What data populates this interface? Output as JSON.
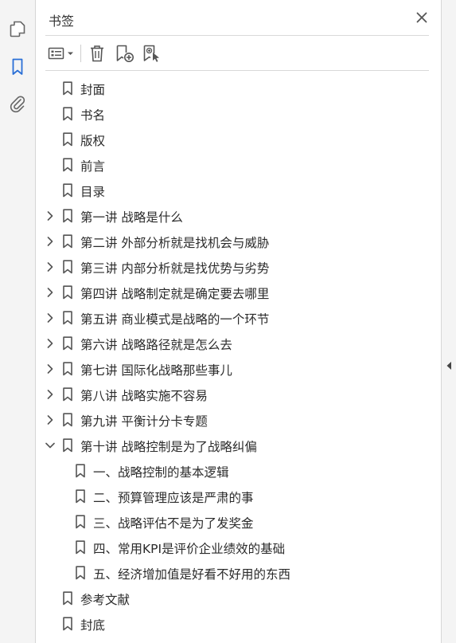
{
  "panel": {
    "title": "书签"
  },
  "icons": {
    "rail": [
      "pages-icon",
      "bookmarks-icon",
      "attachments-icon"
    ],
    "toolbar": [
      "options-menu-icon",
      "delete-bookmark-icon",
      "new-bookmark-icon",
      "new-bookmark-from-structure-icon"
    ],
    "close": "close-icon"
  },
  "colors": {
    "accent": "#2a6fd6",
    "icon": "#555555",
    "separator": "#d9d9d9"
  },
  "bookmarks": [
    {
      "label": "封面",
      "level": 0,
      "expander": "none"
    },
    {
      "label": "书名",
      "level": 0,
      "expander": "none"
    },
    {
      "label": "版权",
      "level": 0,
      "expander": "none"
    },
    {
      "label": "前言",
      "level": 0,
      "expander": "none"
    },
    {
      "label": "目录",
      "level": 0,
      "expander": "none"
    },
    {
      "label": "第一讲  战略是什么",
      "level": 0,
      "expander": "collapsed"
    },
    {
      "label": "第二讲  外部分析就是找机会与威胁",
      "level": 0,
      "expander": "collapsed"
    },
    {
      "label": "第三讲  内部分析就是找优势与劣势",
      "level": 0,
      "expander": "collapsed"
    },
    {
      "label": "第四讲  战略制定就是确定要去哪里",
      "level": 0,
      "expander": "collapsed"
    },
    {
      "label": "第五讲  商业模式是战略的一个环节",
      "level": 0,
      "expander": "collapsed"
    },
    {
      "label": "第六讲  战略路径就是怎么去",
      "level": 0,
      "expander": "collapsed"
    },
    {
      "label": "第七讲  国际化战略那些事儿",
      "level": 0,
      "expander": "collapsed"
    },
    {
      "label": "第八讲  战略实施不容易",
      "level": 0,
      "expander": "collapsed"
    },
    {
      "label": "第九讲  平衡计分卡专题",
      "level": 0,
      "expander": "collapsed"
    },
    {
      "label": "第十讲  战略控制是为了战略纠偏",
      "level": 0,
      "expander": "expanded"
    },
    {
      "label": "一、战略控制的基本逻辑",
      "level": 1,
      "expander": "none"
    },
    {
      "label": "二、预算管理应该是严肃的事",
      "level": 1,
      "expander": "none"
    },
    {
      "label": "三、战略评估不是为了发奖金",
      "level": 1,
      "expander": "none"
    },
    {
      "label": "四、常用KPI是评价企业绩效的基础",
      "level": 1,
      "expander": "none"
    },
    {
      "label": "五、经济增加值是好看不好用的东西",
      "level": 1,
      "expander": "none"
    },
    {
      "label": "参考文献",
      "level": 0,
      "expander": "none"
    },
    {
      "label": "封底",
      "level": 0,
      "expander": "none"
    }
  ]
}
